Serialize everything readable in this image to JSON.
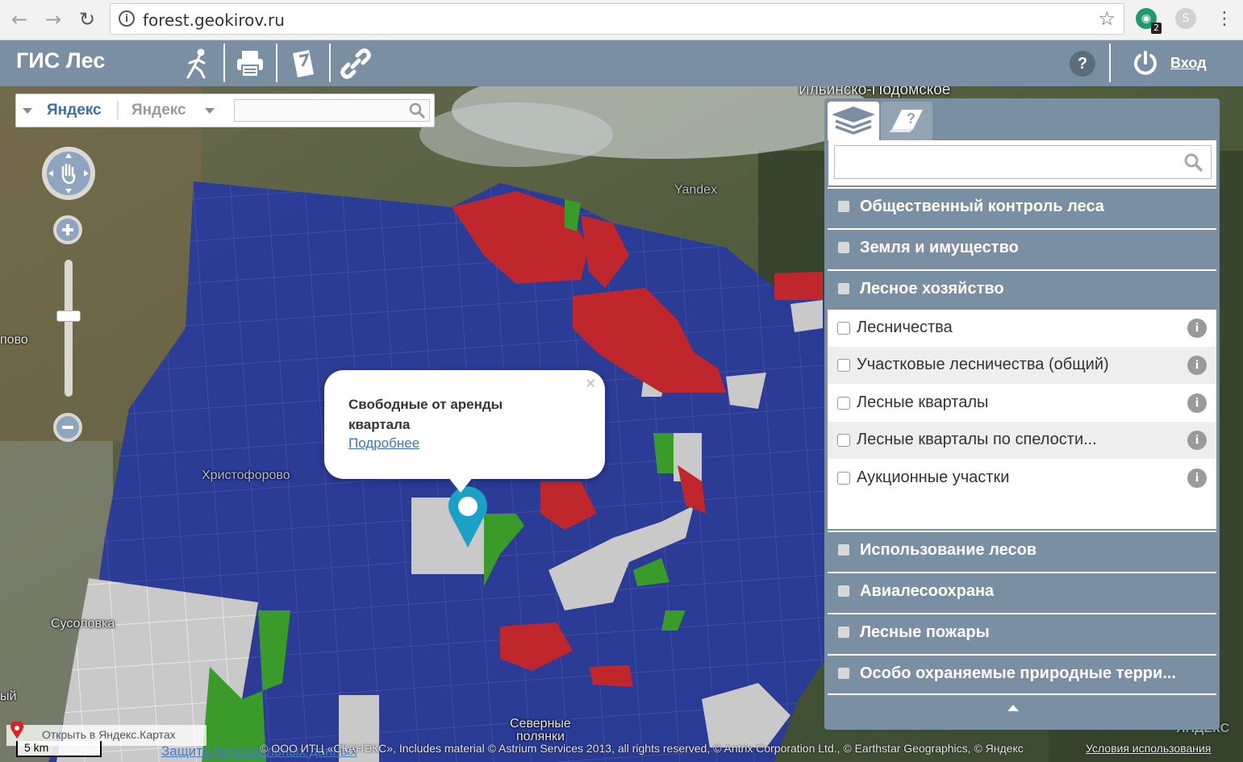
{
  "browser": {
    "url": "forest.geokirov.ru",
    "back_icon": "back-arrow-icon",
    "forward_icon": "forward-arrow-icon",
    "reload_icon": "reload-icon",
    "extension_badge": "2"
  },
  "app": {
    "title": "ГИС Лес",
    "help_label": "?",
    "login_label": "Вход",
    "toolbar_icons": [
      "measure-icon",
      "print-icon",
      "bookmark-icon",
      "link-icon"
    ]
  },
  "map": {
    "provider_primary": "Яндекс",
    "provider_secondary": "Яндекс",
    "search_placeholder": "",
    "labels": {
      "ilinsko": "Ильинско-Подомское",
      "yandex_watermark": "Yandex",
      "novo": "пово",
      "khristoforovo": "Христофорово",
      "susolovka": "Сусоловка",
      "severnye": "Северные",
      "polyanki": "полянки",
      "edge_left": "ый",
      "yandex_corner": "ЯНДЕКС"
    },
    "popup": {
      "title": "Свободные от аренды квартала",
      "link": "Подробнее",
      "close": "×"
    },
    "open_in_yandex": "Открыть в Яндекс.Картах",
    "scale": "5 km",
    "attribution": "© ООО ИТЦ «СКАНЭКС», Includes material © Astrium Services 2013, all rights reserved, © Antrix Corporation Ltd., © Earthstar Geographics, © Яндекс",
    "terms": "Условия использования",
    "privacy": "Защита персональных данных",
    "colors": {
      "leased": "#2a3a9a",
      "free": "#c9c9c9",
      "red": "#c0272d",
      "green": "#3a9a2a",
      "marker": "#1ba1c5"
    }
  },
  "panel": {
    "tabs": [
      {
        "icon": "layers-icon"
      },
      {
        "icon": "legend-icon"
      }
    ],
    "search_placeholder": "",
    "sections_top": [
      {
        "label": "Общественный контроль леса"
      },
      {
        "label": "Земля и имущество"
      },
      {
        "label": "Лесное хозяйство"
      }
    ],
    "forestry_layers": [
      {
        "label": "Лесничества"
      },
      {
        "label": "Участковые лесничества (общий)"
      },
      {
        "label": "Лесные кварталы"
      },
      {
        "label": "Лесные кварталы по спелости..."
      },
      {
        "label": "Аукционные участки"
      }
    ],
    "sections_bottom": [
      {
        "label": "Использование лесов"
      },
      {
        "label": "Авиалесоохрана"
      },
      {
        "label": "Лесные пожары"
      },
      {
        "label": "Особо охраняемые природные терри..."
      }
    ],
    "info_glyph": "i"
  }
}
